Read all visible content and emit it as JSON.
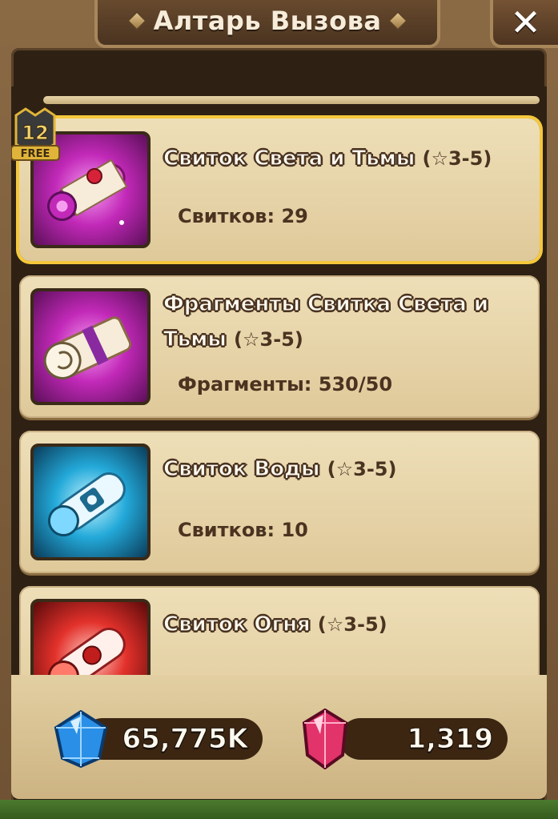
{
  "header": {
    "title": "Алтарь Вызова",
    "close_label": "✕"
  },
  "scrolls": [
    {
      "name": "Свиток Света и Тьмы",
      "stars": "(☆3-5)",
      "count_label": "Свитков: 29",
      "icon": "light-dark-scroll-icon",
      "badge_number": "12",
      "badge_text": "FREE",
      "selected": true
    },
    {
      "name_line1": "Фрагменты Свитка Света и",
      "name_line2": "Тьмы",
      "stars": "(☆3-5)",
      "count_label": "Фрагменты: 530/50",
      "icon": "light-dark-fragment-icon"
    },
    {
      "name": "Свиток Воды",
      "stars": "(☆3-5)",
      "count_label": "Свитков: 10",
      "icon": "water-scroll-icon"
    },
    {
      "name": "Свиток Огня",
      "stars": "(☆3-5)",
      "icon": "fire-scroll-icon"
    }
  ],
  "currency": {
    "crystals": "65,775K",
    "gems": "1,319",
    "crystal_icon": "blue-crystal-icon",
    "gem_icon": "red-gem-icon"
  },
  "colors": {
    "panel_bg": "#2e2114",
    "card_bg": "#eedfb8",
    "selected_border": "#f5c83c",
    "title_text": "#f6ecd9"
  }
}
